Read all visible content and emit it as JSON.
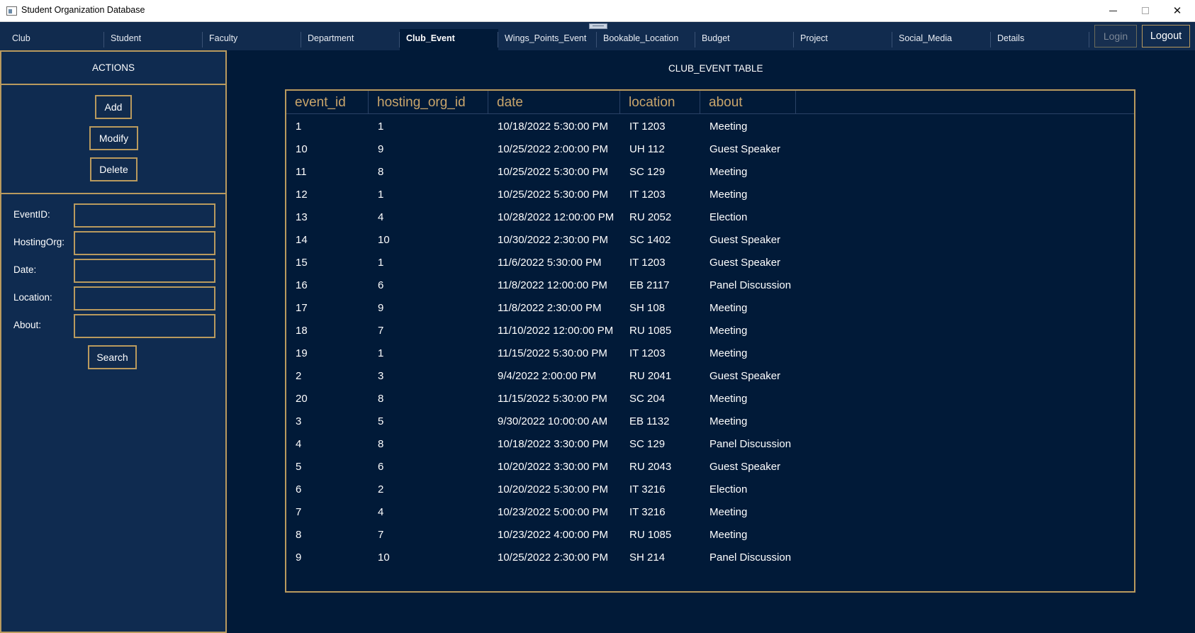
{
  "window": {
    "title": "Student Organization Database"
  },
  "tabs": [
    {
      "label": "Club",
      "active": false
    },
    {
      "label": "Student",
      "active": false
    },
    {
      "label": "Faculty",
      "active": false
    },
    {
      "label": "Department",
      "active": false
    },
    {
      "label": "Club_Event",
      "active": true
    },
    {
      "label": "Wings_Points_Event",
      "active": false
    },
    {
      "label": "Bookable_Location",
      "active": false
    },
    {
      "label": "Budget",
      "active": false
    },
    {
      "label": "Project",
      "active": false
    },
    {
      "label": "Social_Media",
      "active": false
    },
    {
      "label": "Details",
      "active": false
    }
  ],
  "auth": {
    "login_label": "Login",
    "login_enabled": false,
    "logout_label": "Logout"
  },
  "side": {
    "header": "ACTIONS",
    "add_label": "Add",
    "modify_label": "Modify",
    "delete_label": "Delete",
    "fields": [
      {
        "label": "EventID:",
        "value": ""
      },
      {
        "label": "HostingOrg:",
        "value": ""
      },
      {
        "label": "Date:",
        "value": ""
      },
      {
        "label": "Location:",
        "value": ""
      },
      {
        "label": "About:",
        "value": ""
      }
    ],
    "search_label": "Search"
  },
  "main": {
    "table_title": "CLUB_EVENT TABLE",
    "columns": [
      "event_id",
      "hosting_org_id",
      "date",
      "location",
      "about"
    ],
    "rows": [
      [
        "1",
        "1",
        "10/18/2022 5:30:00 PM",
        "IT 1203",
        "Meeting"
      ],
      [
        "10",
        "9",
        "10/25/2022 2:00:00 PM",
        "UH 112",
        "Guest Speaker"
      ],
      [
        "11",
        "8",
        "10/25/2022 5:30:00 PM",
        "SC 129",
        "Meeting"
      ],
      [
        "12",
        "1",
        "10/25/2022 5:30:00 PM",
        "IT 1203",
        "Meeting"
      ],
      [
        "13",
        "4",
        "10/28/2022 12:00:00 PM",
        "RU 2052",
        "Election"
      ],
      [
        "14",
        "10",
        "10/30/2022 2:30:00 PM",
        "SC 1402",
        "Guest Speaker"
      ],
      [
        "15",
        "1",
        "11/6/2022 5:30:00 PM",
        "IT 1203",
        "Guest Speaker"
      ],
      [
        "16",
        "6",
        "11/8/2022 12:00:00 PM",
        "EB 2117",
        "Panel Discussion"
      ],
      [
        "17",
        "9",
        "11/8/2022 2:30:00 PM",
        "SH 108",
        "Meeting"
      ],
      [
        "18",
        "7",
        "11/10/2022 12:00:00 PM",
        "RU 1085",
        "Meeting"
      ],
      [
        "19",
        "1",
        "11/15/2022 5:30:00 PM",
        "IT 1203",
        "Meeting"
      ],
      [
        "2",
        "3",
        "9/4/2022 2:00:00 PM",
        "RU 2041",
        "Guest Speaker"
      ],
      [
        "20",
        "8",
        "11/15/2022 5:30:00 PM",
        "SC 204",
        "Meeting"
      ],
      [
        "3",
        "5",
        "9/30/2022 10:00:00 AM",
        "EB 1132",
        "Meeting"
      ],
      [
        "4",
        "8",
        "10/18/2022 3:30:00 PM",
        "SC 129",
        "Panel Discussion"
      ],
      [
        "5",
        "6",
        "10/20/2022 3:30:00 PM",
        "RU 2043",
        "Guest Speaker"
      ],
      [
        "6",
        "2",
        "10/20/2022 5:30:00 PM",
        "IT 3216",
        "Election"
      ],
      [
        "7",
        "4",
        "10/23/2022 5:00:00 PM",
        "IT 3216",
        "Meeting"
      ],
      [
        "8",
        "7",
        "10/23/2022 4:00:00 PM",
        "RU 1085",
        "Meeting"
      ],
      [
        "9",
        "10",
        "10/25/2022 2:30:00 PM",
        "SH 214",
        "Panel Discussion"
      ]
    ]
  },
  "colors": {
    "background": "#011a38",
    "panel": "#0f2b50",
    "accent_border": "#b99a5e",
    "header_text": "#c9a56b"
  }
}
